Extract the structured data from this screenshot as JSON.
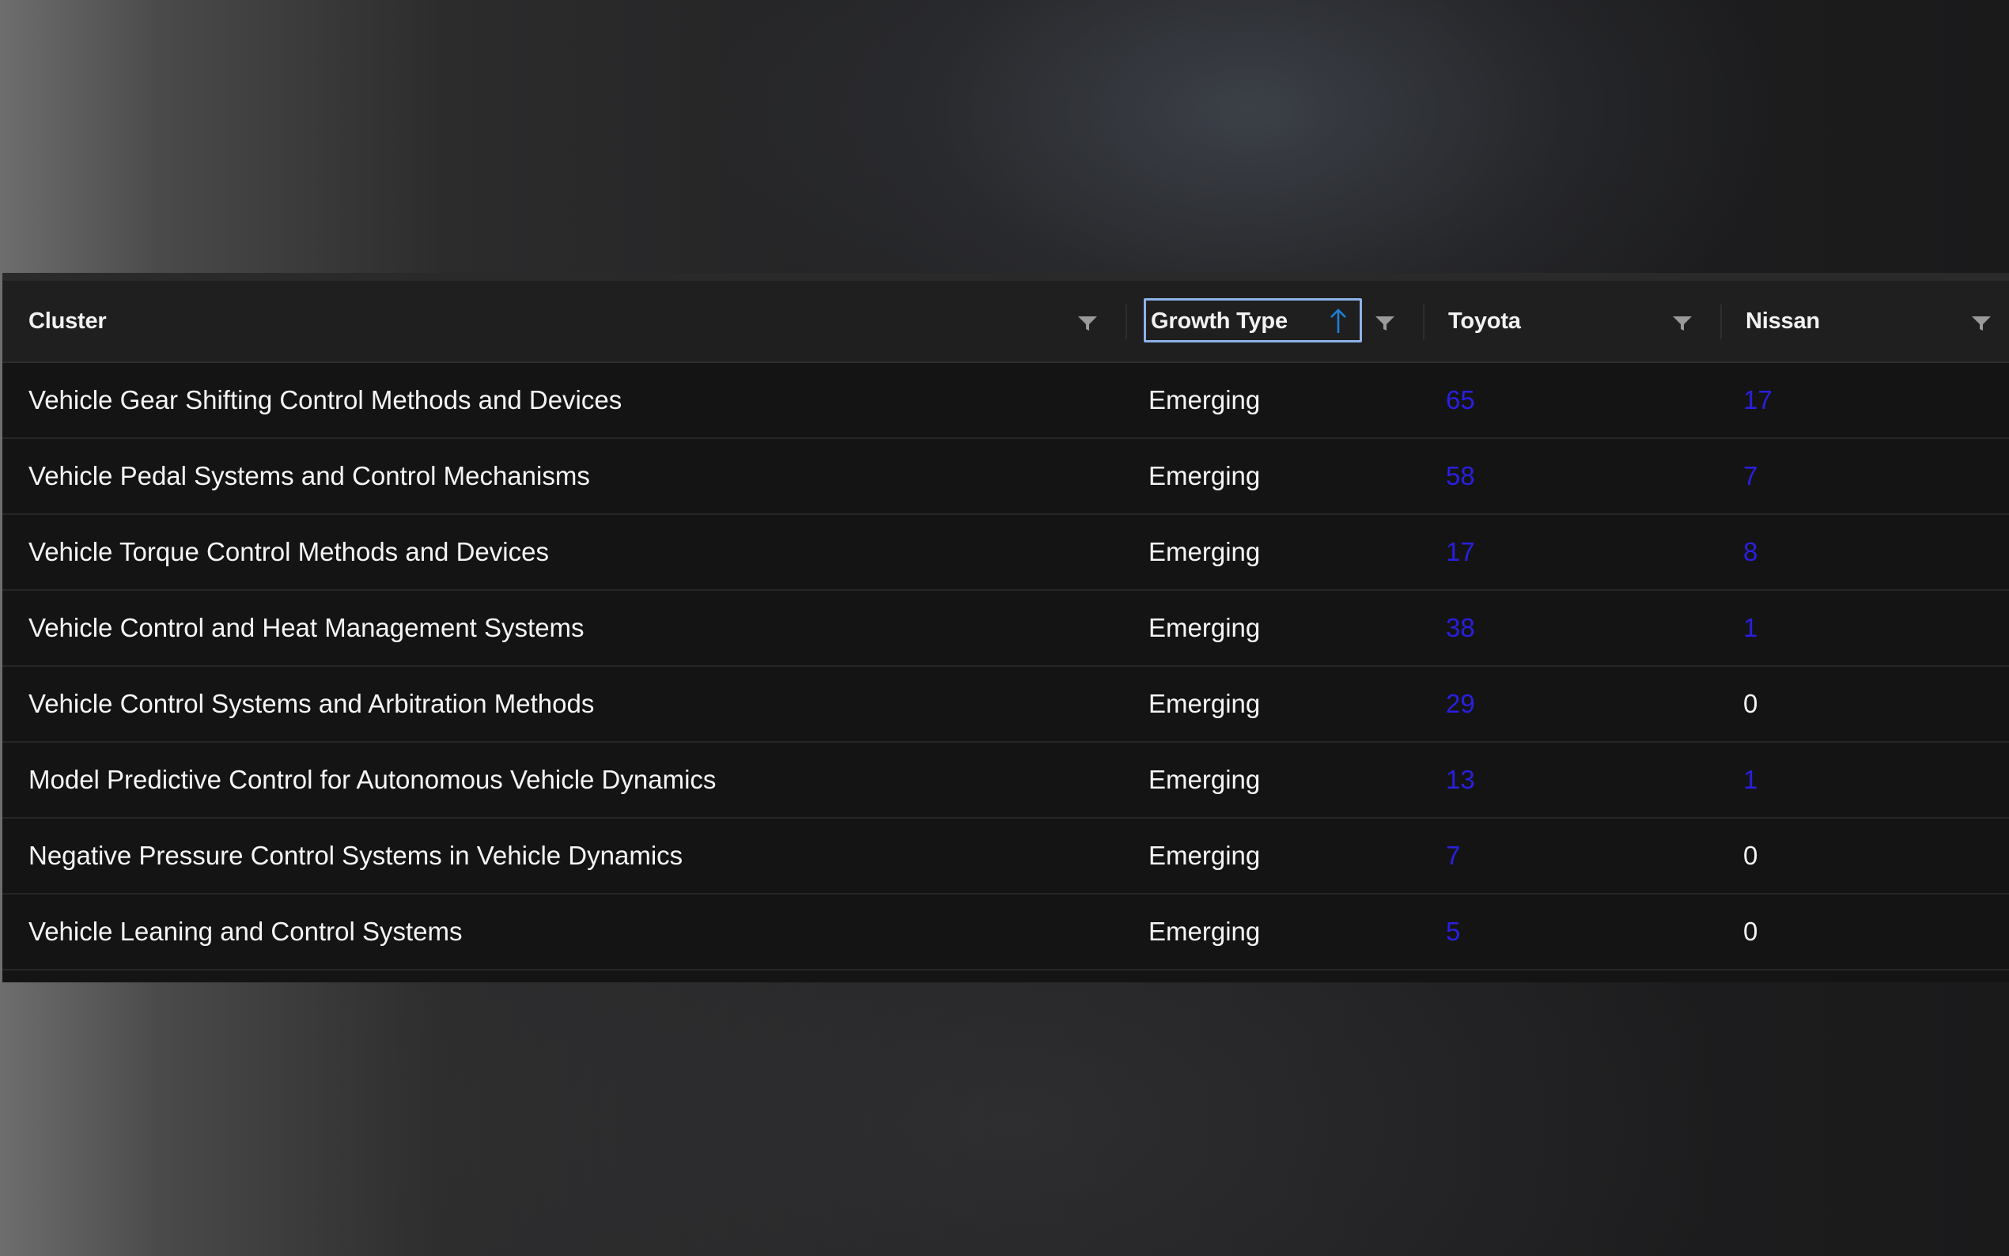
{
  "table": {
    "columns": [
      {
        "label": "Cluster"
      },
      {
        "label": "Growth Type",
        "sort": "ascending"
      },
      {
        "label": "Toyota"
      },
      {
        "label": "Nissan"
      }
    ],
    "rows": [
      {
        "cluster": "Vehicle Gear Shifting Control Methods and Devices",
        "growth_type": "Emerging",
        "toyota": "65",
        "nissan": "17"
      },
      {
        "cluster": "Vehicle Pedal Systems and Control Mechanisms",
        "growth_type": "Emerging",
        "toyota": "58",
        "nissan": "7"
      },
      {
        "cluster": "Vehicle Torque Control Methods and Devices",
        "growth_type": "Emerging",
        "toyota": "17",
        "nissan": "8"
      },
      {
        "cluster": "Vehicle Control and Heat Management Systems",
        "growth_type": "Emerging",
        "toyota": "38",
        "nissan": "1"
      },
      {
        "cluster": "Vehicle Control Systems and Arbitration Methods",
        "growth_type": "Emerging",
        "toyota": "29",
        "nissan": "0"
      },
      {
        "cluster": "Model Predictive Control for Autonomous Vehicle Dynamics",
        "growth_type": "Emerging",
        "toyota": "13",
        "nissan": "1"
      },
      {
        "cluster": "Negative Pressure Control Systems in Vehicle Dynamics",
        "growth_type": "Emerging",
        "toyota": "7",
        "nissan": "0"
      },
      {
        "cluster": "Vehicle Leaning and Control Systems",
        "growth_type": "Emerging",
        "toyota": "5",
        "nissan": "0"
      }
    ]
  },
  "colors": {
    "link_value": "#2a1fe0",
    "plain_value": "#f5f5f5",
    "sort_focus_border": "#8db3e8",
    "sort_icon": "#1f7fd4",
    "filter_icon": "#9a9a9a"
  },
  "icons": {
    "filter": "filter-icon",
    "sort": "arrow-up-icon"
  }
}
